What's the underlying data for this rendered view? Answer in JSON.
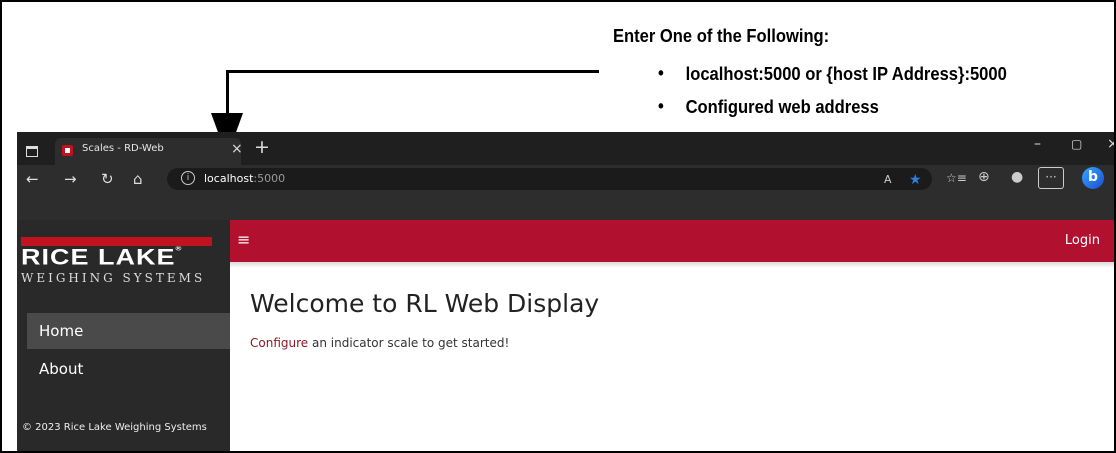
{
  "callout": {
    "title": "Enter One of the Following:",
    "bullets": [
      "localhost:5000 or {host IP Address}:5000",
      "Configured web address"
    ]
  },
  "browser": {
    "tab_title": "Scales - RD-Web",
    "tab_close": "×",
    "new_tab": "+",
    "window_controls": {
      "minimize": "–",
      "maximize": "▢",
      "close": "×"
    },
    "nav": {
      "back": "←",
      "forward": "→",
      "refresh": "↻",
      "home": "⌂"
    },
    "info_icon": "i",
    "url_host": "localhost",
    "url_port": ":5000",
    "toolbar": {
      "read_aloud": "A",
      "favorite": "★",
      "favorites_bar": "☆≡",
      "collections": "⊕",
      "profile": "●",
      "more": "···",
      "copilot": "b"
    }
  },
  "app": {
    "brand": {
      "name": "RICE LAKE",
      "trademark": "®",
      "tagline": "WEIGHING SYSTEMS"
    },
    "sidebar": {
      "items": [
        {
          "label": "Home"
        },
        {
          "label": "About"
        }
      ],
      "footer": "© 2023 Rice Lake Weighing Systems"
    },
    "topbar": {
      "menu": "≡",
      "login": "Login"
    },
    "main": {
      "heading": "Welcome to RL Web Display",
      "intro_link": "Configure",
      "intro_text": " an indicator scale to get started!"
    }
  },
  "colors": {
    "brand_red": "#b1102e",
    "sidebar": "#292929",
    "browser_chrome": "#1f1f1f",
    "favorite_star": "#2f7fe0"
  },
  "icons": [
    "tab-actions-icon",
    "site-favicon",
    "close-icon",
    "plus-icon",
    "back-arrow-icon",
    "forward-arrow-icon",
    "refresh-icon",
    "home-icon",
    "info-icon",
    "read-aloud-icon",
    "star-icon",
    "favorites-icon",
    "collections-icon",
    "profile-icon",
    "more-icon",
    "copilot-icon",
    "hamburger-icon",
    "callout-arrow-icon"
  ]
}
